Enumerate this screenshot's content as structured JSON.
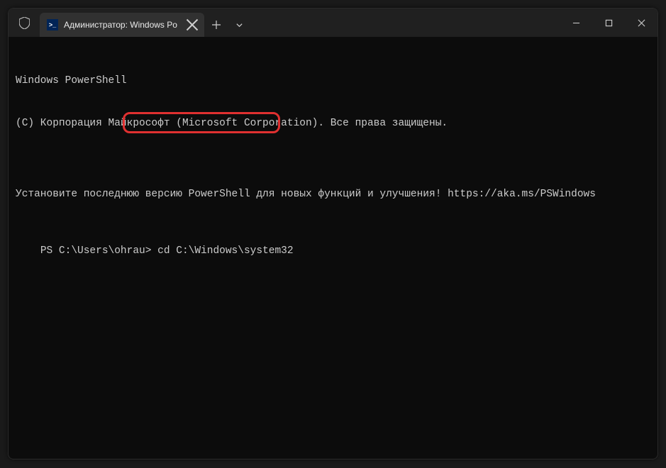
{
  "titlebar": {
    "tab_title": "Администратор: Windows Po",
    "tab_icon_text": ">_"
  },
  "terminal": {
    "line1": "Windows PowerShell",
    "line2": "(C) Корпорация Майкрософт (Microsoft Corporation). Все права защищены.",
    "line3": "",
    "line4": "Установите последнюю версию PowerShell для новых функций и улучшения! https://aka.ms/PSWindows",
    "line5": "",
    "prompt": "PS C:\\Users\\ohrau> ",
    "command": "cd C:\\Windows\\system32"
  }
}
